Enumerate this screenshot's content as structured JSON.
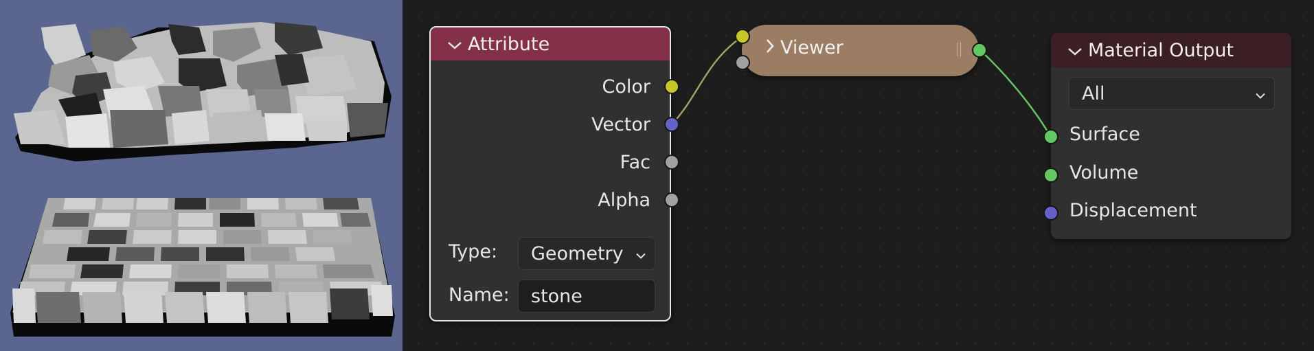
{
  "viewport": {
    "background": "#5a6690",
    "description_icons": [
      "voronoi-stone-mesh",
      "grid-stone-mesh"
    ]
  },
  "attribute_node": {
    "title": "Attribute",
    "header_color": "#833048",
    "outputs": [
      {
        "label": "Color",
        "socket_color": "#c7c729"
      },
      {
        "label": "Vector",
        "socket_color": "#6363c7"
      },
      {
        "label": "Fac",
        "socket_color": "#a1a1a1"
      },
      {
        "label": "Alpha",
        "socket_color": "#a1a1a1"
      }
    ],
    "type_label": "Type:",
    "type_value": "Geometry",
    "name_label": "Name:",
    "name_value": "stone"
  },
  "viewer_node": {
    "title": "Viewer",
    "color": "#9b7d63"
  },
  "material_output_node": {
    "title": "Material Output",
    "header_color": "#3c1e25",
    "target_value": "All",
    "inputs": [
      {
        "label": "Surface",
        "socket_color": "#63c763"
      },
      {
        "label": "Volume",
        "socket_color": "#63c763"
      },
      {
        "label": "Displacement",
        "socket_color": "#6363c7"
      }
    ]
  }
}
